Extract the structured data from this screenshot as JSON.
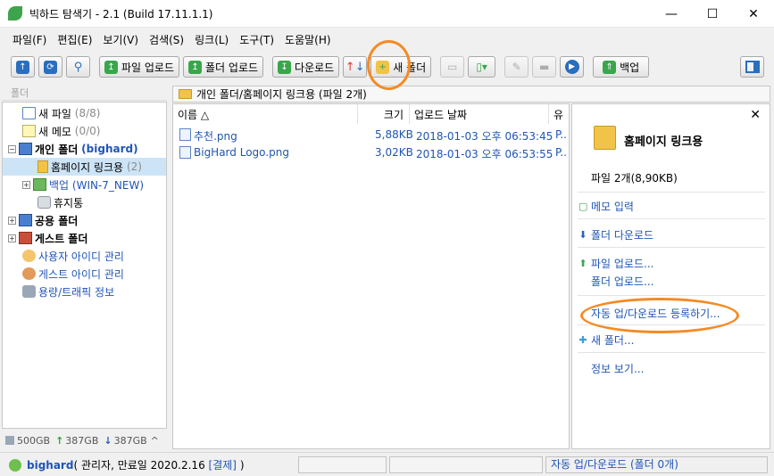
{
  "window": {
    "title": "빅하드 탐색기 - 2.1 (Build 17.11.1.1)",
    "minimize": "—",
    "maximize": "☐",
    "close": "✕"
  },
  "menu": [
    "파일(F)",
    "편집(E)",
    "보기(V)",
    "검색(S)",
    "링크(L)",
    "도구(T)",
    "도움말(H)"
  ],
  "toolbar": {
    "upload_file": "파일 업로드",
    "upload_folder": "폴더 업로드",
    "download": "다운로드",
    "new_folder": "새 폴더",
    "backup": "백업"
  },
  "left_panel": {
    "header": "폴더"
  },
  "tree": {
    "new_file": "새 파일",
    "new_file_count": "(8/8)",
    "new_memo": "새 메모",
    "new_memo_count": "(0/0)",
    "personal_folder": "개인 폴더",
    "personal_owner": "(bighard)",
    "homepage_link": "홈페이지 링크용",
    "homepage_link_count": "(2)",
    "backup": "백업 (WIN-7_NEW)",
    "trash": "휴지통",
    "public_folder": "공용 폴더",
    "guest_folder": "게스트 폴더",
    "user_id_mgmt": "사용자 아이디 관리",
    "guest_id_mgmt": "게스트 아이디 관리",
    "usage_info": "용량/트래픽 정보"
  },
  "left_status": {
    "total": "500GB",
    "up": "387GB",
    "down": "387GB",
    "caret": "^"
  },
  "path": "개인 폴더/홈페이지 링크용 (파일 2개)",
  "filelist": {
    "columns": {
      "name": "이름 △",
      "size": "크기",
      "date": "업로드 날짜",
      "extra": "유"
    },
    "rows": [
      {
        "name": "추천.png",
        "size": "5,88KB",
        "date": "2018-01-03 오후 06:53:45",
        "extra": "P.."
      },
      {
        "name": "BigHard Logo.png",
        "size": "3,02KB",
        "date": "2018-01-03 오후 06:53:55",
        "extra": "P.."
      }
    ]
  },
  "side_panel": {
    "close": "✕",
    "title": "홈페이지 링크용",
    "count": "파일 2개(8,90KB)",
    "memo": "메모 입력",
    "folder_download": "폴더 다운로드",
    "file_upload": "파일 업로드...",
    "folder_upload": "폴더 업로드...",
    "auto_register": "자동 업/다운로드 등록하기...",
    "new_folder": "새 폴더...",
    "info": "정보 보기..."
  },
  "statusbar": {
    "user": "bighard",
    "user_info": "( 관리자, 만료일 2020.2.16",
    "payment": "[결제]",
    "close_paren": ")",
    "right": "자동 업/다운로드 (폴더 0개)"
  },
  "colors": {
    "accent": "#1f55b5",
    "annotation": "#f58a23",
    "selection": "#cde4f7",
    "green": "#3aa64b"
  }
}
